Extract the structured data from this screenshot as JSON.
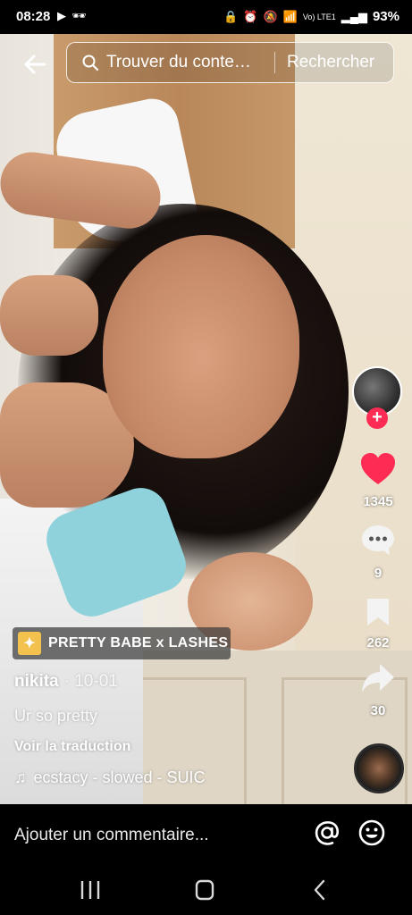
{
  "status_bar": {
    "time": "08:28",
    "network_label": "Vo) LTE1",
    "battery": "93%"
  },
  "search": {
    "query": "Trouver du conte…",
    "button_label": "Rechercher"
  },
  "actions": {
    "likes": "1345",
    "comments": "9",
    "saves": "262",
    "shares": "30"
  },
  "effect_chip": {
    "label": "PRETTY BABE x LASHES"
  },
  "post": {
    "username": "nikita",
    "date": "· 10-01",
    "description": "Ur so pretty",
    "translate_label": "Voir la traduction",
    "music": "ecstacy - slowed - SUIC"
  },
  "comment_bar": {
    "placeholder": "Ajouter un commentaire..."
  },
  "colors": {
    "like": "#fe2c55",
    "accent": "#fe2c55",
    "chip_icon": "#f2c14e"
  },
  "icons": [
    "back-arrow-icon",
    "search-icon",
    "heart-icon",
    "comment-icon",
    "bookmark-icon",
    "share-icon",
    "music-note-icon",
    "at-icon",
    "emoji-icon",
    "recent-apps-icon",
    "home-icon",
    "back-icon"
  ]
}
